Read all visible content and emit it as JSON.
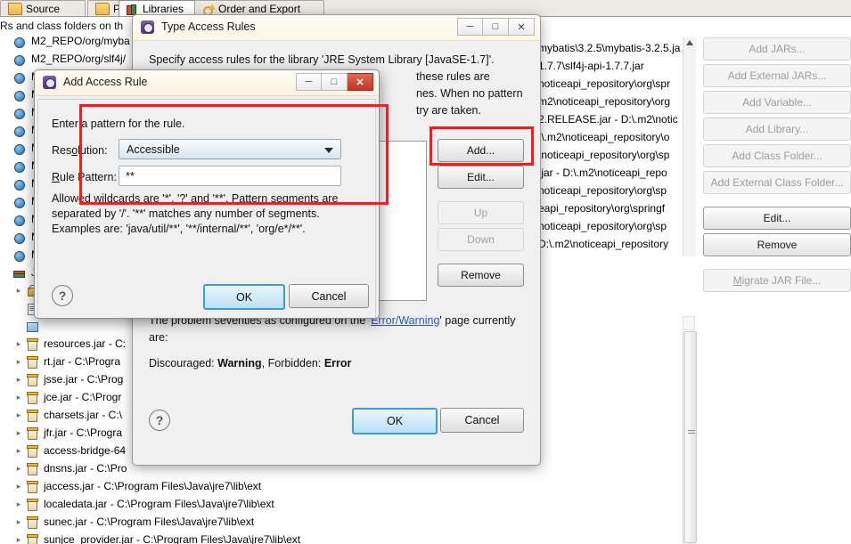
{
  "background": {
    "tabs": [
      {
        "label": "Source",
        "icon": "source-icon",
        "active": false
      },
      {
        "label": "Projects",
        "icon": "projects-folder-icon",
        "active": false
      },
      {
        "label": "Libraries",
        "icon": "libraries-icon",
        "active": true
      },
      {
        "label": "Order and Export",
        "icon": "order-export-icon",
        "active": false
      }
    ],
    "description": "Rs and class folders on th",
    "tree": [
      {
        "label": "M2_REPO/org/myba",
        "icon": "variable-entry-icon",
        "indent": 0,
        "arrow": false
      },
      {
        "label": "M2_REPO/org/slf4j/",
        "icon": "variable-entry-icon",
        "indent": 0,
        "arrow": false
      },
      {
        "label": "M",
        "icon": "variable-entry-icon",
        "indent": 0,
        "arrow": false
      },
      {
        "label": "M",
        "icon": "variable-entry-icon",
        "indent": 0,
        "arrow": false
      },
      {
        "label": "M",
        "icon": "variable-entry-icon",
        "indent": 0,
        "arrow": false
      },
      {
        "label": "M",
        "icon": "variable-entry-icon",
        "indent": 0,
        "arrow": false
      },
      {
        "label": "M",
        "icon": "variable-entry-icon",
        "indent": 0,
        "arrow": false
      },
      {
        "label": "M",
        "icon": "variable-entry-icon",
        "indent": 0,
        "arrow": false
      },
      {
        "label": "M",
        "icon": "variable-entry-icon",
        "indent": 0,
        "arrow": false
      },
      {
        "label": "M",
        "icon": "variable-entry-icon",
        "indent": 0,
        "arrow": false
      },
      {
        "label": "M",
        "icon": "variable-entry-icon",
        "indent": 0,
        "arrow": false
      },
      {
        "label": "M",
        "icon": "variable-entry-icon",
        "indent": 0,
        "arrow": false
      },
      {
        "label": "M",
        "icon": "variable-entry-icon",
        "indent": 0,
        "arrow": false
      },
      {
        "label": "J",
        "icon": "jre-library-icon",
        "indent": 0,
        "arrow": false
      },
      {
        "label": "",
        "icon": "access-rules-icon",
        "indent": 1,
        "arrow": true
      },
      {
        "label": "",
        "icon": "javadoc-icon",
        "indent": 1,
        "arrow": false
      },
      {
        "label": "",
        "icon": "source-attachment-icon",
        "indent": 1,
        "arrow": false
      },
      {
        "label": "resources.jar - C:",
        "icon": "jar-icon",
        "indent": 1,
        "arrow": true
      },
      {
        "label": "rt.jar - C:\\Progra",
        "icon": "jar-icon",
        "indent": 1,
        "arrow": true
      },
      {
        "label": "jsse.jar - C:\\Prog",
        "icon": "jar-icon",
        "indent": 1,
        "arrow": true
      },
      {
        "label": "jce.jar - C:\\Progr",
        "icon": "jar-icon",
        "indent": 1,
        "arrow": true
      },
      {
        "label": "charsets.jar - C:\\",
        "icon": "jar-icon",
        "indent": 1,
        "arrow": true
      },
      {
        "label": "jfr.jar - C:\\Progra",
        "icon": "jar-icon",
        "indent": 1,
        "arrow": true
      },
      {
        "label": "access-bridge-64",
        "icon": "jar-icon",
        "indent": 1,
        "arrow": true
      },
      {
        "label": "dnsns.jar - C:\\Pro",
        "icon": "jar-icon",
        "indent": 1,
        "arrow": true
      },
      {
        "label": "jaccess.jar - C:\\Program Files\\Java\\jre7\\lib\\ext",
        "icon": "jar-icon",
        "indent": 1,
        "arrow": true
      },
      {
        "label": "localedata.jar - C:\\Program Files\\Java\\jre7\\lib\\ext",
        "icon": "jar-icon",
        "indent": 1,
        "arrow": true
      },
      {
        "label": "sunec.jar - C:\\Program Files\\Java\\jre7\\lib\\ext",
        "icon": "jar-icon",
        "indent": 1,
        "arrow": true
      },
      {
        "label": "sunjce_provider.jar - C:\\Program Files\\Java\\jre7\\lib\\ext",
        "icon": "jar-icon",
        "indent": 1,
        "arrow": true
      }
    ],
    "jar_paths": [
      "mybatis\\3.2.5\\mybatis-3.2.5.ja",
      "1.7.7\\slf4j-api-1.7.7.jar",
      "noticeapi_repository\\org\\spr",
      "m2\\noticeapi_repository\\org",
      "2.RELEASE.jar - D:\\.m2\\notic",
      ":\\.m2\\noticeapi_repository\\o",
      "\\noticeapi_repository\\org\\sp",
      ".jar - D:\\.m2\\noticeapi_repo",
      "noticeapi_repository\\org\\sp",
      "eapi_repository\\org\\springf",
      "noticeapi_repository\\org\\sp",
      "D:\\.m2\\noticeapi_repository"
    ],
    "buttons": [
      {
        "label": "Add JARs...",
        "enabled": false
      },
      {
        "label": "Add External JARs...",
        "enabled": false
      },
      {
        "label": "Add Variable...",
        "enabled": false
      },
      {
        "label": "Add Library...",
        "enabled": false
      },
      {
        "label": "Add Class Folder...",
        "enabled": false
      },
      {
        "label": "Add External Class Folder...",
        "enabled": false
      },
      {
        "label": "Edit...",
        "enabled": true
      },
      {
        "label": "Remove",
        "enabled": true
      },
      {
        "label": "Migrate JAR File...",
        "enabled": false
      }
    ]
  },
  "type_access_rules_dialog": {
    "title": "Type Access Rules",
    "window_buttons": {
      "minimize": "─",
      "maximize": "□",
      "close": "✕"
    },
    "message_line1": "Specify access rules for the library 'JRE System Library [JavaSE-1.7]'.",
    "message_line2": "these rules are",
    "message_line3": "nes. When no pattern",
    "message_line4": "try are taken.",
    "side_buttons": [
      {
        "label": "Add...",
        "enabled": true
      },
      {
        "label": "Edit...",
        "enabled": true
      },
      {
        "label": "Up",
        "enabled": false
      },
      {
        "label": "Down",
        "enabled": false
      },
      {
        "label": "Remove",
        "enabled": true
      }
    ],
    "severity_prefix": "The problem severities as configured on the '",
    "severity_link": "Error/Warning",
    "severity_suffix": "' page currently are:",
    "severity_values_prefix": "Discouraged: ",
    "severity_discouraged": "Warning",
    "severity_mid": ", Forbidden: ",
    "severity_forbidden": "Error",
    "help_label": "?",
    "ok_label": "OK",
    "cancel_label": "Cancel"
  },
  "add_access_rule_dialog": {
    "title": "Add Access Rule",
    "window_buttons": {
      "minimize": "─",
      "maximize": "□",
      "close": "✕"
    },
    "instruction": "Enter a pattern for the rule.",
    "resolution_label_pre": "Res",
    "resolution_label_accel": "o",
    "resolution_label_post": "lution:",
    "resolution_value": "Accessible",
    "rule_pattern_label_accel": "R",
    "rule_pattern_label_post": "ule Pattern:",
    "rule_pattern_value": "**",
    "hint_line1": "Allowed wildcards are '*', '?' and '**'. Pattern segments are",
    "hint_line2": "separated by '/'. '**' matches any number of segments.",
    "hint_line3": "Examples are: 'java/util/**', '**/internal/**', 'org/e*/**'.",
    "help_label": "?",
    "ok_label": "OK",
    "cancel_label": "Cancel"
  },
  "annotations": {
    "accent_color": "#fb1a1a",
    "boxes": [
      "form-fields-highlight",
      "add-button-highlight"
    ]
  }
}
